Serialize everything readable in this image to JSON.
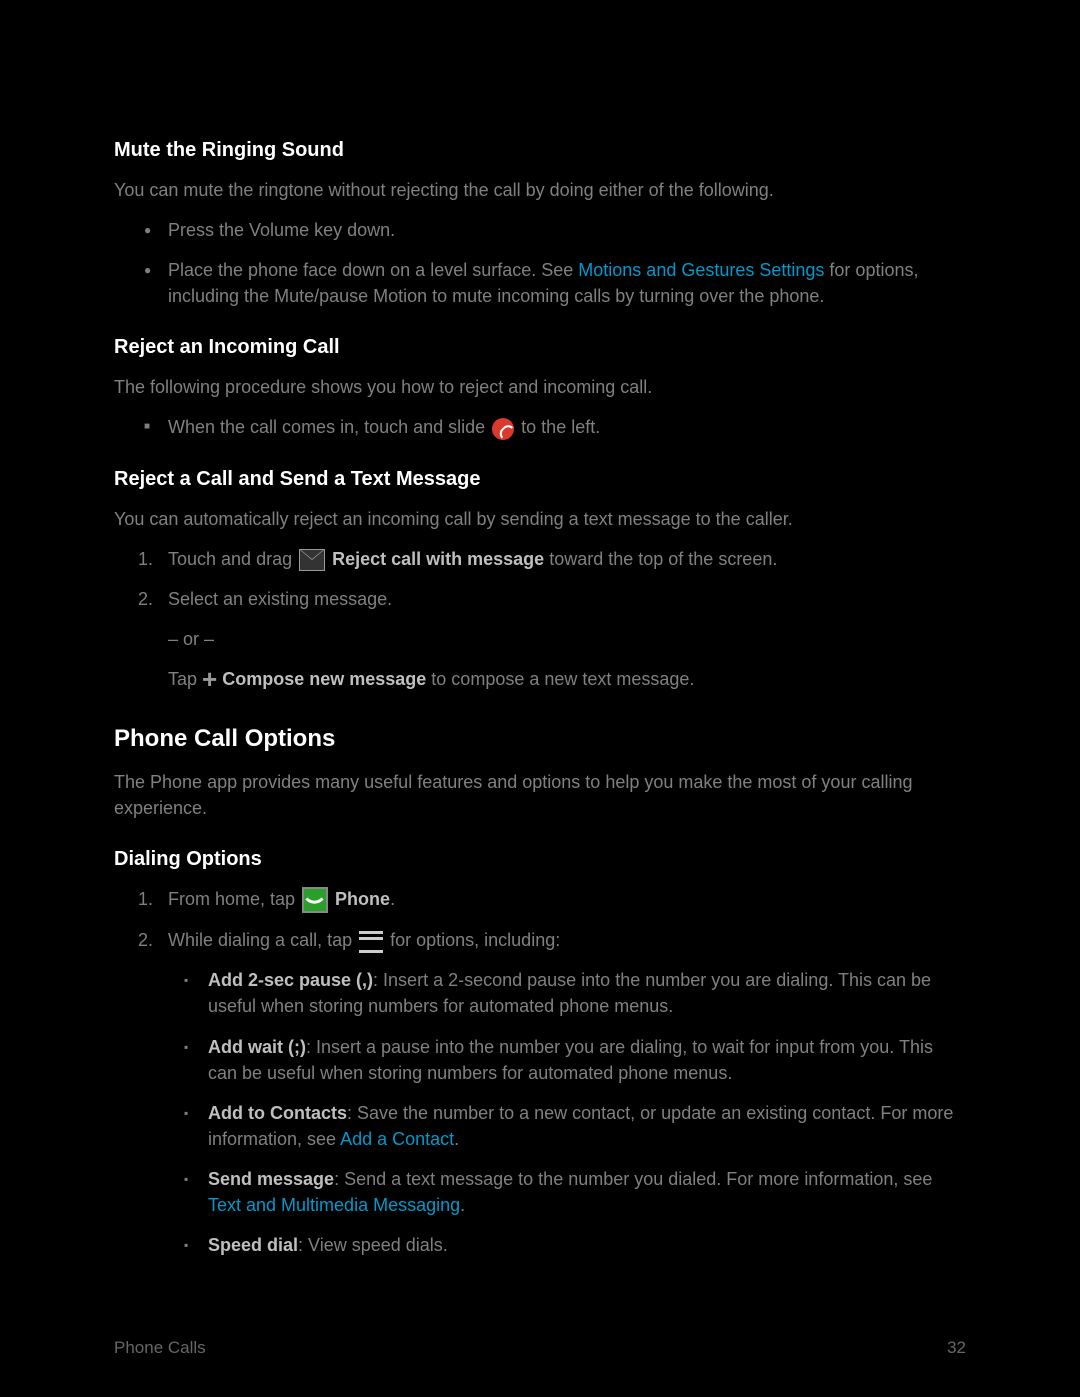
{
  "section1": {
    "heading": "Mute the Ringing Sound",
    "intro": "You can mute the ringtone without rejecting the call by doing either of the following.",
    "items": [
      "Press the Volume key down.",
      {
        "pre": "Place the phone face down on a level surface. See ",
        "link": "Motions and Gestures Settings",
        "post": " for options, including the Mute/pause Motion to mute incoming calls by turning over the phone."
      }
    ]
  },
  "section2": {
    "heading": "Reject an Incoming Call",
    "intro": "The following procedure shows you how to reject and incoming call.",
    "item_pre": "When the call comes in, touch and slide ",
    "item_post": " to the left."
  },
  "section3": {
    "heading": "Reject a Call and Send a Text Message",
    "intro": "You can automatically reject an incoming call by sending a text message to the caller.",
    "step1_pre": "Touch and drag ",
    "step1_bold": " Reject call with message",
    "step1_post": " toward the top of the screen.",
    "step2": "Select an existing message.",
    "or": "– or –",
    "tap_pre": "Tap ",
    "tap_bold": " Compose new message",
    "tap_post": " to compose a new text message."
  },
  "section4": {
    "heading": "Phone Call Options",
    "intro": "The Phone app provides many useful features and options to help you make the most of your calling experience."
  },
  "section5": {
    "heading": "Dialing Options",
    "step1_pre": "From home, tap ",
    "step1_bold": " Phone",
    "step1_post": ".",
    "step2_pre": "While dialing a call, tap ",
    "step2_post": " for options, including:",
    "opts": [
      {
        "b": "Add 2-sec pause (,)",
        "t": ": Insert a 2-second pause into the number you are dialing. This can be useful when storing numbers for automated phone menus."
      },
      {
        "b": "Add wait (;)",
        "t": ": Insert a pause into the number you are dialing, to wait for input from you. This can be useful when storing numbers for automated phone menus."
      },
      {
        "b": "Add to Contacts",
        "t": ": Save the number to a new contact, or update an existing contact. For more information, see ",
        "link": "Add a Contact",
        "post": "."
      },
      {
        "b": "Send message",
        "t": ": Send a text message to the number you dialed. For more information, see ",
        "link": "Text and Multimedia Messaging",
        "post": "."
      },
      {
        "b": "Speed dial",
        "t": ": View speed dials."
      }
    ]
  },
  "footer": {
    "left": "Phone Calls",
    "right": "32"
  }
}
